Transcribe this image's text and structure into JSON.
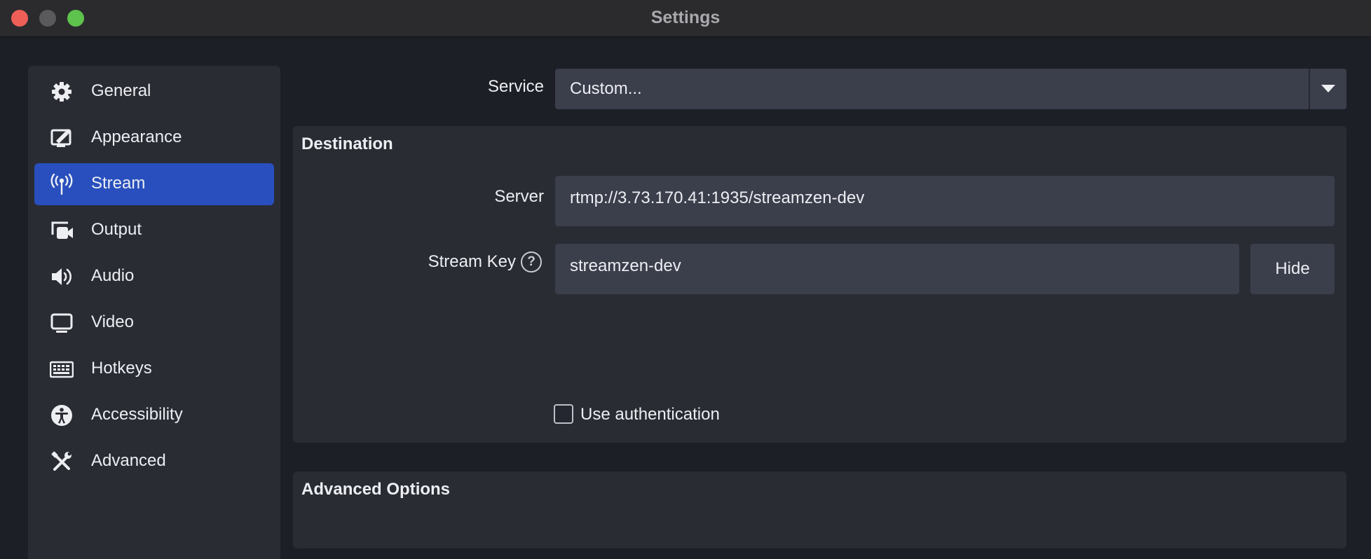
{
  "window": {
    "title": "Settings"
  },
  "sidebar": {
    "items": [
      {
        "label": "General",
        "icon": "gear-icon"
      },
      {
        "label": "Appearance",
        "icon": "appearance-icon"
      },
      {
        "label": "Stream",
        "icon": "antenna-icon",
        "active": true
      },
      {
        "label": "Output",
        "icon": "output-icon"
      },
      {
        "label": "Audio",
        "icon": "speaker-icon"
      },
      {
        "label": "Video",
        "icon": "monitor-icon"
      },
      {
        "label": "Hotkeys",
        "icon": "keyboard-icon"
      },
      {
        "label": "Accessibility",
        "icon": "accessibility-icon"
      },
      {
        "label": "Advanced",
        "icon": "tools-icon"
      }
    ]
  },
  "stream": {
    "service_label": "Service",
    "service_value": "Custom...",
    "destination": {
      "title": "Destination",
      "server_label": "Server",
      "server_value": "rtmp://3.73.170.41:1935/streamzen-dev",
      "stream_key_label": "Stream Key",
      "stream_key_help": "?",
      "stream_key_value": "streamzen-dev",
      "hide_label": "Hide",
      "use_auth_label": "Use authentication",
      "use_auth_checked": false
    },
    "advanced_options": {
      "title": "Advanced Options"
    }
  },
  "colors": {
    "accent": "#284fbd",
    "panel": "#2a2c34",
    "field": "#3b3e4b",
    "background": "#1d1f26"
  }
}
